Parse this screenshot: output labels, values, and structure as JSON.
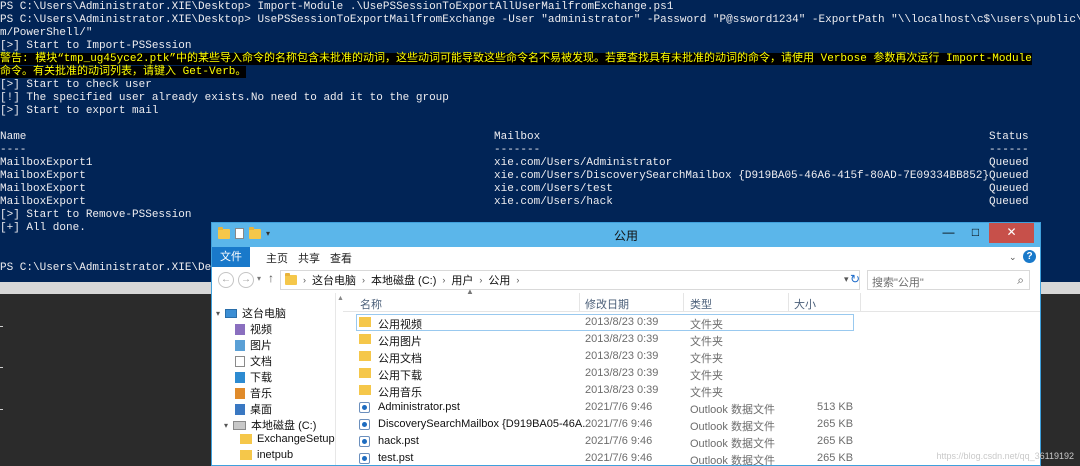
{
  "console": {
    "lines": [
      "PS C:\\Users\\Administrator.XIE\\Desktop> Import-Module .\\UsePSSessionToExportAllUserMailfromExchange.ps1",
      "PS C:\\Users\\Administrator.XIE\\Desktop> UsePSSessionToExportMailfromExchange -User \"administrator\" -Password \"P@ssword1234\" -ExportPath \"\\\\localhost\\c$\\users\\public\\\" -ConnectionUri \"http://m",
      "m/PowerShell/\"",
      "[>] Start to Import-PSSession"
    ],
    "warning_lines": [
      "警告: 模块“tmp_ug45yce2.ptk”中的某些导入命令的名称包含未批准的动词，这些动词可能导致这些命令名不易被发现。若要查找具有未批准的动词的命令，请使用 Verbose 参数再次运行 Import-Module",
      "命令。有关批准的动词列表，请键入 Get-Verb。"
    ],
    "lines2": [
      "[>] Start to check user",
      "[!] The specified user already exists.No need to add it to the group",
      "[>] Start to export mail"
    ],
    "table_headers": {
      "name": "Name",
      "mailbox": "Mailbox",
      "status": "Status"
    },
    "table_dashes": {
      "name": "----",
      "mailbox": "-------",
      "status": "------"
    },
    "table_rows": [
      {
        "name": "MailboxExport1",
        "mailbox": "xie.com/Users/Administrator",
        "status": "Queued"
      },
      {
        "name": "MailboxExport",
        "mailbox": "xie.com/Users/DiscoverySearchMailbox {D919BA05-46A6-415f-80AD-7E09334BB852}",
        "status": "Queued"
      },
      {
        "name": "MailboxExport",
        "mailbox": "xie.com/Users/test",
        "status": "Queued"
      },
      {
        "name": "MailboxExport",
        "mailbox": "xie.com/Users/hack",
        "status": "Queued"
      }
    ],
    "tail_lines": [
      "[>] Start to Remove-PSSession",
      "[+] All done."
    ],
    "prompt": "PS C:\\Users\\Administrator.XIE\\Desktop"
  },
  "explorer": {
    "title": "公用",
    "ribbon_tabs": {
      "file": "文件",
      "home": "主页",
      "share": "共享",
      "view": "查看"
    },
    "breadcrumb": [
      "这台电脑",
      "本地磁盘 (C:)",
      "用户",
      "公用"
    ],
    "search_placeholder": "搜索\"公用\"",
    "nav_items": [
      {
        "label": "这台电脑",
        "icon": "computer-icon"
      },
      {
        "label": "视频",
        "icon": "videos-icon"
      },
      {
        "label": "图片",
        "icon": "pictures-icon"
      },
      {
        "label": "文档",
        "icon": "documents-icon"
      },
      {
        "label": "下载",
        "icon": "downloads-icon"
      },
      {
        "label": "音乐",
        "icon": "music-icon"
      },
      {
        "label": "桌面",
        "icon": "desktop-icon"
      },
      {
        "label": "本地磁盘 (C:)",
        "icon": "drive-icon"
      },
      {
        "label": "ExchangeSetupL",
        "icon": "folder-icon"
      },
      {
        "label": "inetpub",
        "icon": "folder-icon"
      }
    ],
    "columns": {
      "name": "名称",
      "date": "修改日期",
      "type": "类型",
      "size": "大小"
    },
    "files": [
      {
        "name": "公用视频",
        "date": "2013/8/23 0:39",
        "type": "文件夹",
        "size": "",
        "icon": "folder-icon"
      },
      {
        "name": "公用图片",
        "date": "2013/8/23 0:39",
        "type": "文件夹",
        "size": "",
        "icon": "folder-icon"
      },
      {
        "name": "公用文档",
        "date": "2013/8/23 0:39",
        "type": "文件夹",
        "size": "",
        "icon": "folder-icon"
      },
      {
        "name": "公用下载",
        "date": "2013/8/23 0:39",
        "type": "文件夹",
        "size": "",
        "icon": "folder-icon"
      },
      {
        "name": "公用音乐",
        "date": "2013/8/23 0:39",
        "type": "文件夹",
        "size": "",
        "icon": "folder-icon"
      },
      {
        "name": "Administrator.pst",
        "date": "2021/7/6 9:46",
        "type": "Outlook 数据文件",
        "size": "513 KB",
        "icon": "pst-file-icon"
      },
      {
        "name": "DiscoverySearchMailbox {D919BA05-46A...",
        "date": "2021/7/6 9:46",
        "type": "Outlook 数据文件",
        "size": "265 KB",
        "icon": "pst-file-icon"
      },
      {
        "name": "hack.pst",
        "date": "2021/7/6 9:46",
        "type": "Outlook 数据文件",
        "size": "265 KB",
        "icon": "pst-file-icon"
      },
      {
        "name": "test.pst",
        "date": "2021/7/6 9:46",
        "type": "Outlook 数据文件",
        "size": "265 KB",
        "icon": "pst-file-icon"
      }
    ]
  },
  "watermark": "https://blog.csdn.net/qq_36119192",
  "colors": {
    "console_bg": "#012456",
    "console_fg": "#eeedf0",
    "warning_fg": "#ffff00",
    "title_bar": "#5bb6ea",
    "file_tab": "#1979ca"
  }
}
